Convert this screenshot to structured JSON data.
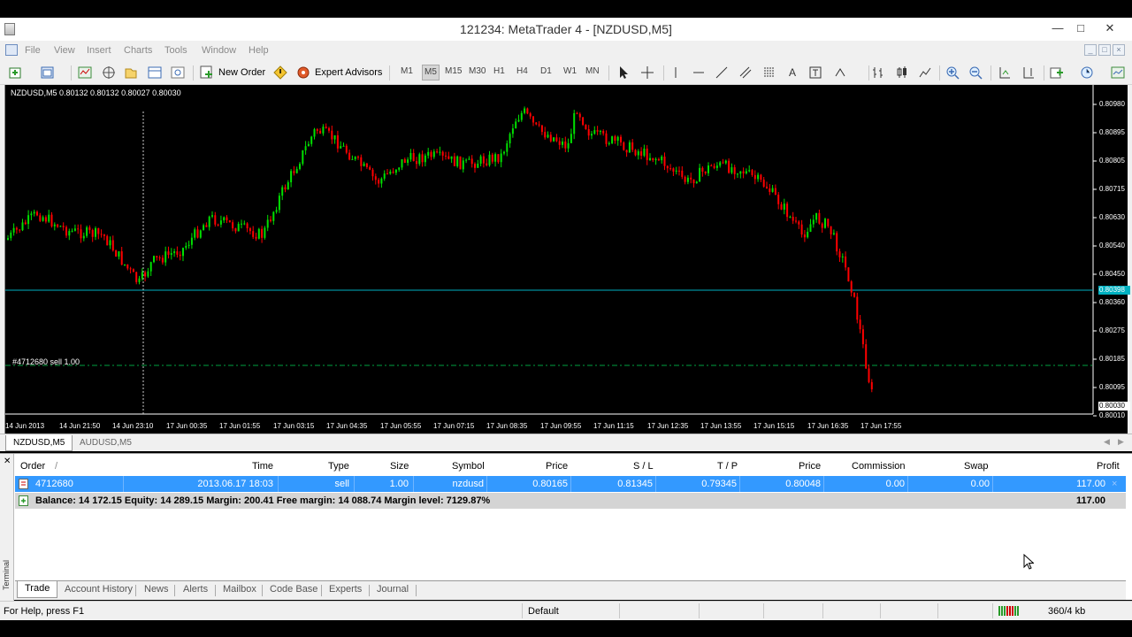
{
  "window": {
    "title": "121234: MetaTrader 4 - [NZDUSD,M5]"
  },
  "menu": [
    "File",
    "View",
    "Insert",
    "Charts",
    "Tools",
    "Window",
    "Help"
  ],
  "toolbar": {
    "new_order": "New Order",
    "expert_advisors": "Expert Advisors",
    "timeframes": [
      "M1",
      "M5",
      "M15",
      "M30",
      "H1",
      "H4",
      "D1",
      "W1",
      "MN"
    ],
    "selected_timeframe": "M5",
    "text_tool": "A"
  },
  "chart": {
    "info": "NZDUSD,M5  0.80132 0.80132 0.80027 0.80030",
    "order_label": "#4712680 sell 1.00",
    "current_price": "0.80398",
    "last_price": "0.80030",
    "colors": {
      "bull": "#00e000",
      "bear": "#ff0000",
      "bid_line": "#00b0c0",
      "order_line": "#00a040",
      "background": "#000000"
    },
    "price_labels": [
      "0.80980",
      "0.80895",
      "0.80805",
      "0.80715",
      "0.80630",
      "0.80540",
      "0.80450",
      "0.80360",
      "0.80275",
      "0.80185",
      "0.80095",
      "0.80010"
    ],
    "time_labels": [
      "14 Jun 2013",
      "14 Jun 21:50",
      "14 Jun 23:10",
      "17 Jun 00:35",
      "17 Jun 01:55",
      "17 Jun 03:15",
      "17 Jun 04:35",
      "17 Jun 05:55",
      "17 Jun 07:15",
      "17 Jun 08:35",
      "17 Jun 09:55",
      "17 Jun 11:15",
      "17 Jun 12:35",
      "17 Jun 13:55",
      "17 Jun 15:15",
      "17 Jun 16:35",
      "17 Jun 17:55"
    ]
  },
  "chart_tabs": [
    "NZDUSD,M5",
    "AUDUSD,M5"
  ],
  "terminal": {
    "side_label": "Terminal",
    "headers": {
      "order": "Order",
      "sort": "/",
      "time": "Time",
      "type": "Type",
      "size": "Size",
      "symbol": "Symbol",
      "price": "Price",
      "sl": "S / L",
      "tp": "T / P",
      "price2": "Price",
      "commission": "Commission",
      "swap": "Swap",
      "profit": "Profit"
    },
    "order_row": {
      "order": "4712680",
      "time": "2013.06.17 18:03",
      "type": "sell",
      "size": "1.00",
      "symbol": "nzdusd",
      "price": "0.80165",
      "sl": "0.81345",
      "tp": "0.79345",
      "price2": "0.80048",
      "commission": "0.00",
      "swap": "0.00",
      "profit": "117.00"
    },
    "balance_row": {
      "summary": "Balance: 14 172.15  Equity: 14 289.15  Margin: 200.41  Free margin: 14 088.74  Margin level: 7129.87%",
      "profit": "117.00"
    },
    "tabs": [
      "Trade",
      "Account History",
      "News",
      "Alerts",
      "Mailbox",
      "Code Base",
      "Experts",
      "Journal"
    ]
  },
  "status": {
    "help": "For Help, press F1",
    "profile": "Default",
    "traffic": "360/4 kb"
  }
}
